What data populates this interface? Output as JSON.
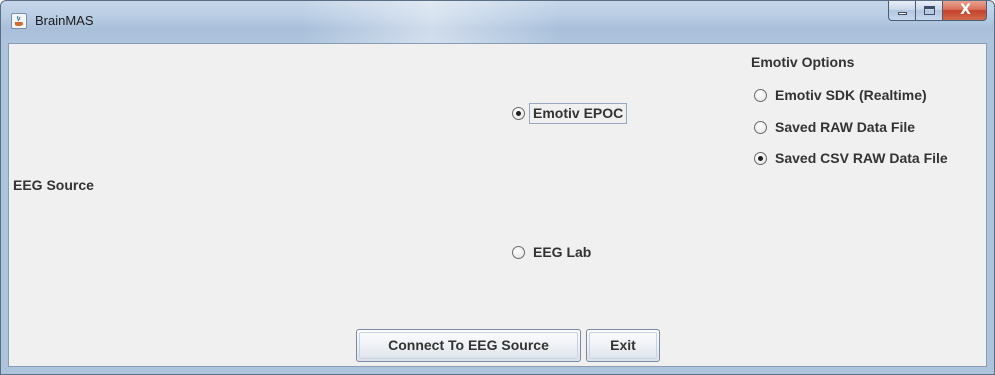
{
  "window": {
    "title": "BrainMAS",
    "app_icon": "java-cup-icon",
    "controls": {
      "minimize_icon": "minimize-icon",
      "maximize_icon": "maximize-icon",
      "close_icon": "close-icon",
      "close_glyph": "X"
    }
  },
  "main": {
    "eeg_source_label": "EEG Source",
    "source_options": [
      {
        "label": "Emotiv EPOC",
        "selected": true
      },
      {
        "label": "EEG Lab",
        "selected": false
      }
    ],
    "emotiv_options": {
      "heading": "Emotiv Options",
      "items": [
        {
          "label": "Emotiv SDK (Realtime)",
          "selected": false
        },
        {
          "label": "Saved RAW Data File",
          "selected": false
        },
        {
          "label": "Saved CSV RAW Data File",
          "selected": true
        }
      ]
    },
    "buttons": {
      "connect_label": "Connect To EEG Source",
      "exit_label": "Exit"
    }
  },
  "colors": {
    "titlebar": "#b9cde4",
    "content_bg": "#f0f0f0",
    "close_button": "#c4412a",
    "text": "#333333"
  }
}
